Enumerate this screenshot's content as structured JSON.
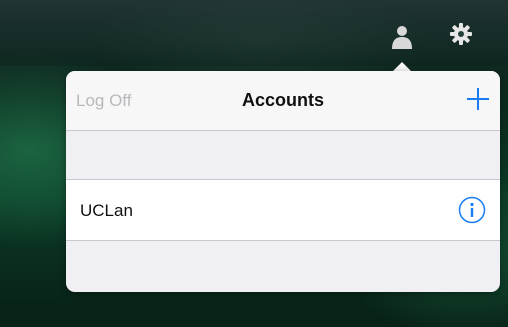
{
  "toolbar": {
    "icons": [
      "user-icon",
      "gear-icon"
    ]
  },
  "accounts_popover": {
    "title": "Accounts",
    "log_off_label": "Log Off",
    "add_icon": "plus-icon",
    "accounts": [
      {
        "name": "UCLan",
        "info_icon": "info-icon"
      }
    ]
  },
  "colors": {
    "accent": "#1a7cf5",
    "disabled_text": "#b9b9bd",
    "header_bg": "#f7f7f7",
    "group_bg": "#efeff4"
  }
}
